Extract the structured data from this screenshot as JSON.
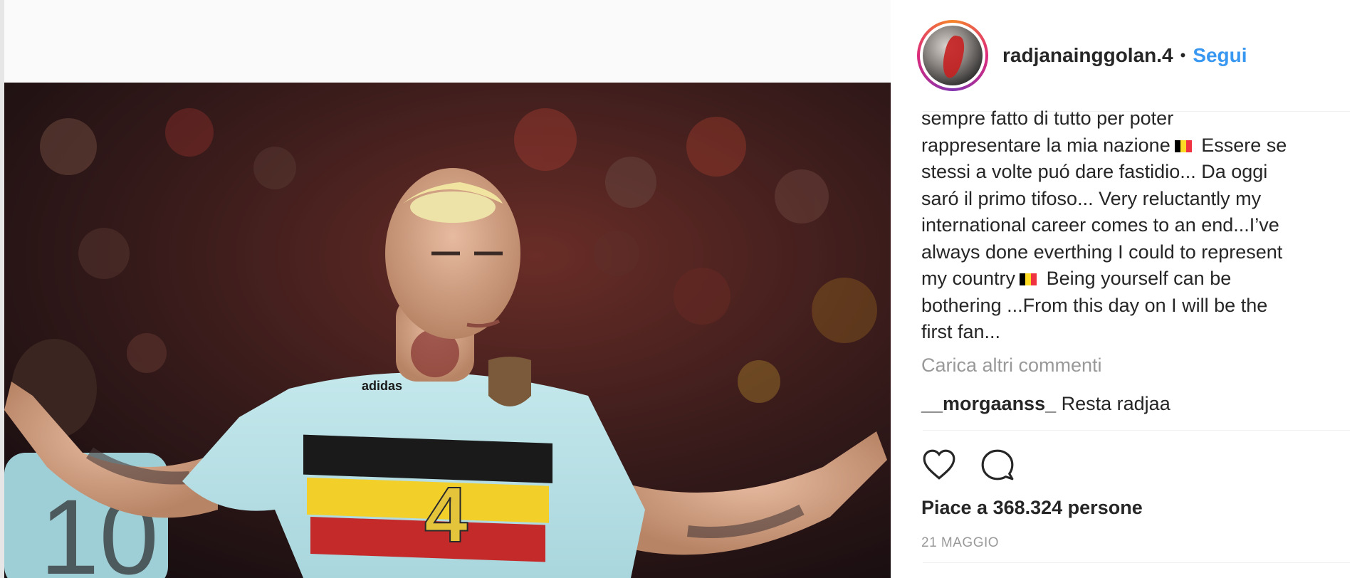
{
  "post": {
    "username": "radjanainggolan.4",
    "separator": "•",
    "follow_label": "Segui",
    "caption_lines": [
      "sempre fatto di tutto per poter",
      "rappresentare la mia nazione",
      "stessi a volte puó dare fastidio... Da oggi",
      "saró il primo tifoso... Very reluctantly my",
      "international career comes to an end...I’ve",
      "always done everthing I could to represent",
      "my country",
      "bothering ...From this day on I will be the",
      "first fan..."
    ],
    "caption_after_flag_1": "Essere se",
    "caption_after_flag_2": "Being yourself can be",
    "flag_colors": [
      "#000000",
      "#fdda24",
      "#ef3340"
    ],
    "load_more_label": "Carica altri commenti",
    "comments": [
      {
        "user": "__morgaanss_",
        "text": "Resta radjaa"
      }
    ],
    "actions": [
      {
        "icon": "heart-icon"
      },
      {
        "icon": "comment-icon"
      }
    ],
    "likes_text": "Piace a 368.324 persone",
    "date": "21 MAGGIO"
  },
  "photo": {
    "jersey_number": "4",
    "jersey_brand": "adidas"
  }
}
